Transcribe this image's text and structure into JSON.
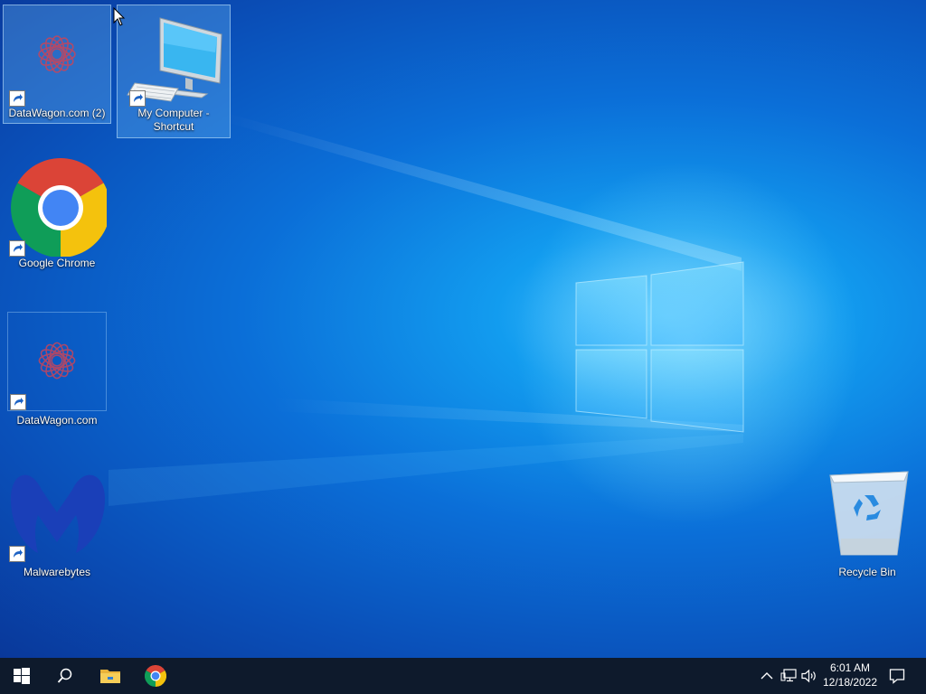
{
  "desktop": {
    "icons": [
      {
        "label": "DataWagon.com (2)",
        "icon": "datawagon-icon",
        "shortcut": true,
        "selected": true
      },
      {
        "label": "My Computer - Shortcut",
        "icon": "computer-icon",
        "shortcut": true,
        "selected": true
      },
      {
        "label": "Google Chrome",
        "icon": "chrome-icon",
        "shortcut": true,
        "selected": false
      },
      {
        "label": "DataWagon.com",
        "icon": "datawagon-icon",
        "shortcut": true,
        "selected": false
      },
      {
        "label": "Malwarebytes",
        "icon": "malwarebytes-icon",
        "shortcut": true,
        "selected": false
      },
      {
        "label": "Recycle Bin",
        "icon": "recycle-bin-icon",
        "shortcut": false,
        "selected": false
      }
    ]
  },
  "taskbar": {
    "buttons": [
      {
        "name": "start",
        "icon": "windows-start-icon"
      },
      {
        "name": "search",
        "icon": "search-icon"
      },
      {
        "name": "file-explorer",
        "icon": "folder-icon"
      },
      {
        "name": "google-chrome",
        "icon": "chrome-icon"
      }
    ],
    "tray": {
      "icons": [
        "chevron-up-icon",
        "network-icon",
        "volume-icon"
      ],
      "time": "6:01 AM",
      "date": "12/18/2022",
      "notification_icon": "action-center-icon"
    }
  },
  "colors": {
    "taskbar": "#0e1a2c",
    "wallpaper_glow": "#4fc6ff",
    "wallpaper_base": "#0a4fb8"
  }
}
